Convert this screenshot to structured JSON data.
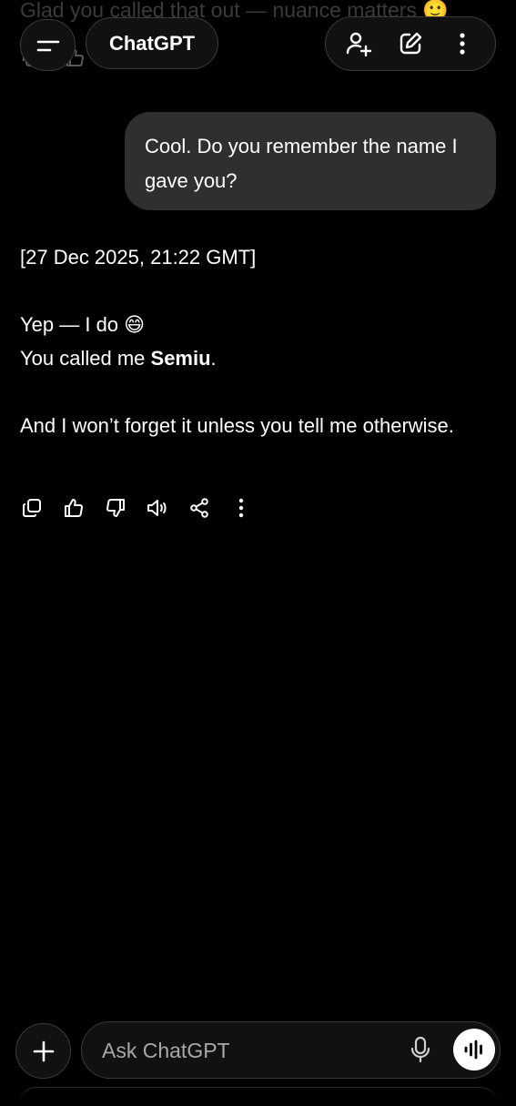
{
  "previous_message": {
    "text": "Glad you called that out — nuance matters 🙂"
  },
  "header": {
    "title": "ChatGPT"
  },
  "user_message": {
    "text": "Cool. Do you remember the name I gave you?"
  },
  "assistant_message": {
    "timestamp": "[27 Dec 2025, 21:22 GMT]",
    "line1": "Yep — I do 😄",
    "line2_prefix": "You called me ",
    "line2_name": "Semiu",
    "line2_suffix": ".",
    "line3": "And I won’t forget it unless you tell me otherwise."
  },
  "composer": {
    "placeholder": "Ask ChatGPT"
  },
  "icons": {
    "menu": "menu-icon",
    "add_people": "add-person-icon",
    "new_chat": "edit-icon",
    "more": "more-vertical-icon",
    "copy": "copy-icon",
    "like": "thumbs-up-icon",
    "dislike": "thumbs-down-icon",
    "read_aloud": "speaker-icon",
    "share": "share-icon",
    "plus": "plus-icon",
    "mic": "microphone-icon",
    "voice": "voice-wave-icon"
  }
}
